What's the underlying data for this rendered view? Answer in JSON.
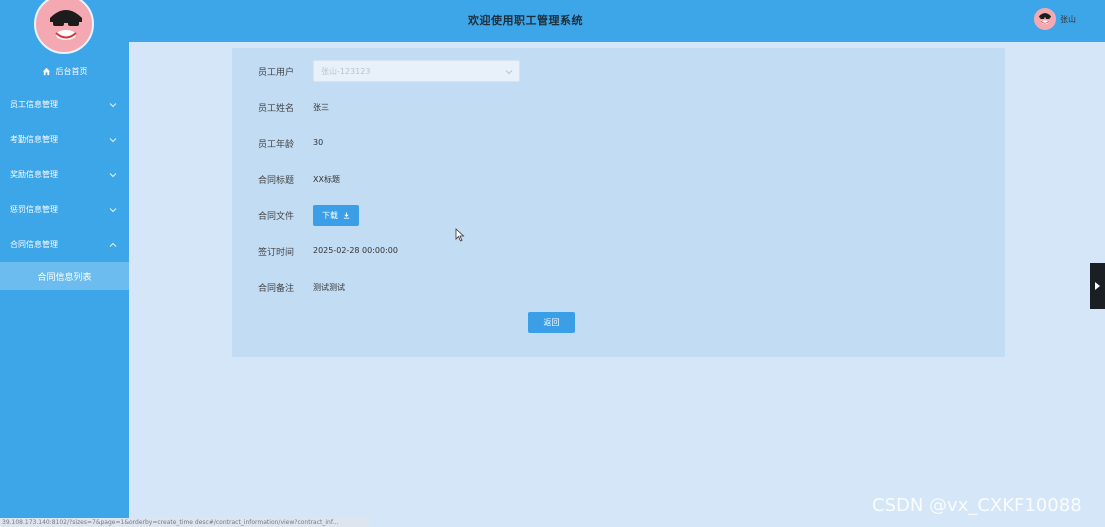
{
  "header": {
    "title": "欢迎使用职工管理系统",
    "username": "张山"
  },
  "sidebar": {
    "home_label": "后台首页",
    "items": [
      {
        "label": "员工信息管理"
      },
      {
        "label": "考勤信息管理"
      },
      {
        "label": "奖励信息管理"
      },
      {
        "label": "惩罚信息管理"
      },
      {
        "label": "合同信息管理"
      }
    ],
    "submenu": {
      "label": "合同信息列表"
    }
  },
  "form": {
    "user": {
      "label": "员工用户",
      "value": "张山-123123"
    },
    "name": {
      "label": "员工姓名",
      "value": "张三"
    },
    "age": {
      "label": "员工年龄",
      "value": "30"
    },
    "title": {
      "label": "合同标题",
      "value": "XX标题"
    },
    "file": {
      "label": "合同文件",
      "button": "下载"
    },
    "sign_time": {
      "label": "签订时间",
      "value": "2025-02-28 00:00:00"
    },
    "remark": {
      "label": "合同备注",
      "value": "测试测试"
    },
    "back_button": "返回"
  },
  "status_bar": "39.108.173.140:8102/?sizes=7&page=1&orderby=create_time desc#/contract_information/view?contract_inf...",
  "watermark": "CSDN @vx_CXKF10088"
}
